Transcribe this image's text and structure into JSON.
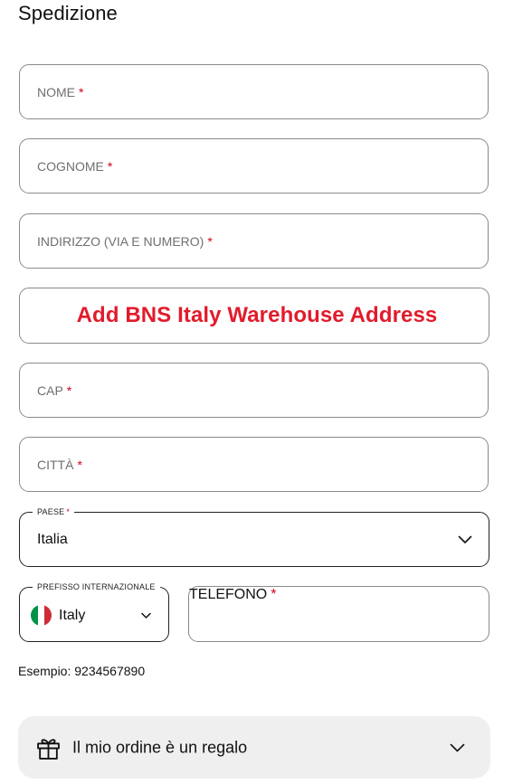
{
  "section": {
    "title": "Spedizione"
  },
  "fields": {
    "nome": "NOME",
    "cognome": "COGNOME",
    "indirizzo": "INDIRIZZO (VIA E NUMERO)",
    "cap": "CAP",
    "citta": "CITTÀ",
    "telefono": "TELEFONO"
  },
  "required_marker": "*",
  "banner": {
    "text": "Add BNS Italy Warehouse Address",
    "color": "#e21b2b"
  },
  "country": {
    "label": "PAESE",
    "value": "Italia"
  },
  "phone_prefix": {
    "label": "PREFISSO INTERNAZIONALE",
    "value": "Italy",
    "flag_colors": [
      "#009246",
      "#ffffff",
      "#ce2b37"
    ]
  },
  "phone_hint": "Esempio: 9234567890",
  "gift": {
    "label": "Il mio ordine è un regalo"
  },
  "icons": {
    "dropdown": "chevron-down-icon",
    "gift": "gift-icon",
    "flag": "italy-flag-icon"
  }
}
